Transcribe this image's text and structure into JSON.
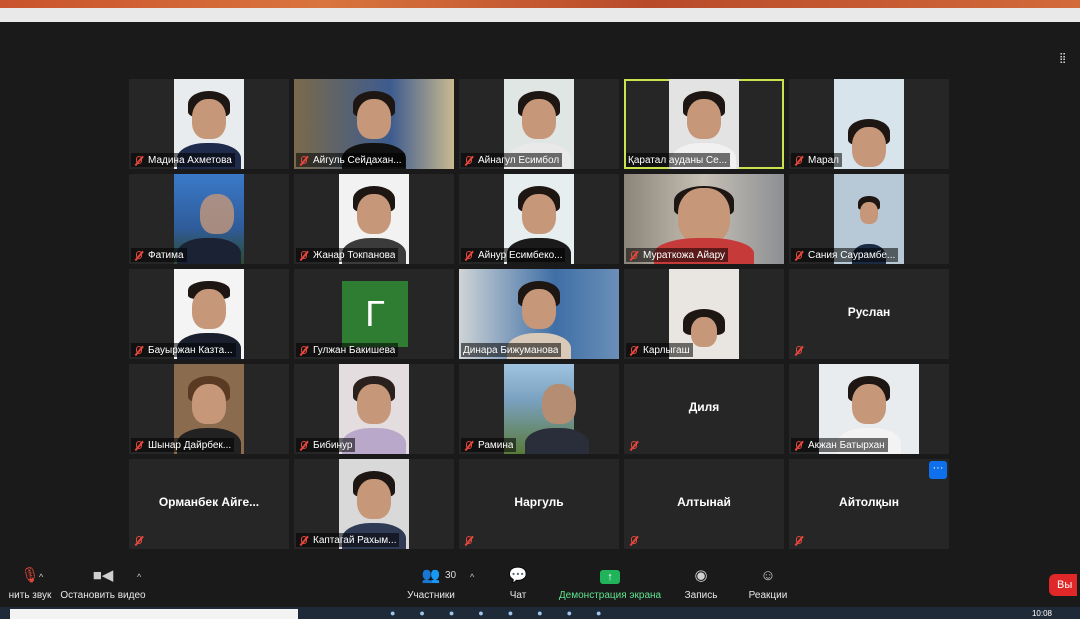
{
  "toolbar": {
    "mute_label": "нить звук",
    "video_label": "Остановить видео",
    "participants_label": "Участники",
    "participants_count": "30",
    "chat_label": "Чат",
    "share_label": "Демонстрация экрана",
    "record_label": "Запись",
    "reactions_label": "Реакции",
    "end_label": "Вы"
  },
  "taskbar": {
    "clock": "10:08"
  },
  "tiles": [
    {
      "name": "Мадина Ахметова"
    },
    {
      "name": "Айгуль Сейдахан..."
    },
    {
      "name": "Айнагул Есимбол"
    },
    {
      "name": "Қаратал ауданы Се..."
    },
    {
      "name": "Марал"
    },
    {
      "name": "Фатима"
    },
    {
      "name": "Жанар Токпанова"
    },
    {
      "name": "Айнур Есимбеко..."
    },
    {
      "name": "Мураткожа Айару"
    },
    {
      "name": "Сания Саурамбе..."
    },
    {
      "name": "Бауыржан Казта..."
    },
    {
      "name": "Гулжан Бакишева",
      "avatar": "Г"
    },
    {
      "name": "Динара Бижуманова"
    },
    {
      "name": "Карлыгаш"
    },
    {
      "name": "Руслан"
    },
    {
      "name": "Шынар Дайрбек..."
    },
    {
      "name": "Бибинур"
    },
    {
      "name": "Рамина"
    },
    {
      "name": "Диля"
    },
    {
      "name": "Акжан Батырхан"
    },
    {
      "name": "Орманбек  Айге..."
    },
    {
      "name": "Каптагай Рахым..."
    },
    {
      "name": "Наргуль"
    },
    {
      "name": "Алтынай"
    },
    {
      "name": "Айтолқын"
    }
  ],
  "colors": {
    "speaking": "#c8e34c",
    "muted": "#e5473c",
    "share": "#21b35a",
    "end": "#e02828"
  }
}
